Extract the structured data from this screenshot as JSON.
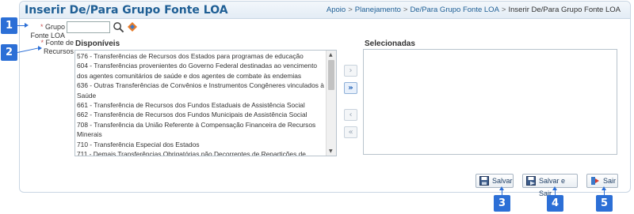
{
  "header": {
    "title": "Inserir De/Para Grupo Fonte LOA",
    "breadcrumb": [
      "Apoio",
      "Planejamento",
      "De/Para Grupo Fonte LOA",
      "Inserir De/Para Grupo Fonte LOA"
    ]
  },
  "form": {
    "grupo_label_req": "*",
    "grupo_label": "Grupo Fonte LOA",
    "grupo_value": "",
    "fonte_label_req": "*",
    "fonte_label": "Fonte de Recursos"
  },
  "disponiveis": {
    "title": "Disponíveis",
    "items": [
      "576 - Transferências de Recursos dos Estados para programas de educação",
      "604 - Transferências provenientes do Governo Federal destinadas ao vencimento dos agentes comunitários de saúde e dos agentes de combate às endemias",
      "636 - Outras Transferências de Convênios e Instrumentos Congêneres vinculados à Saúde",
      "661 - Transferência de Recursos dos Fundos Estaduais de Assistência Social",
      "662 - Transferência de Recursos dos Fundos Municipais de Assistência Social",
      "708 - Transferência da União Referente à Compensação Financeira de Recursos Minerais",
      "710 - Transferência Especial dos Estados",
      "711 - Demais Transferências Obrigatórias não Decorrentes de Repartições de"
    ]
  },
  "selecionadas": {
    "title": "Selecionadas"
  },
  "move_buttons": {
    "add_one": "›",
    "add_all": "»",
    "remove_one": "‹",
    "remove_all": "«"
  },
  "buttons": {
    "salvar": "Salvar",
    "salvar_sair": "Salvar e Sair",
    "sair": "Sair"
  },
  "badges": [
    "1",
    "2",
    "3",
    "4",
    "5"
  ],
  "colors": {
    "accent": "#2c6fd6",
    "title": "#1f5f95"
  }
}
